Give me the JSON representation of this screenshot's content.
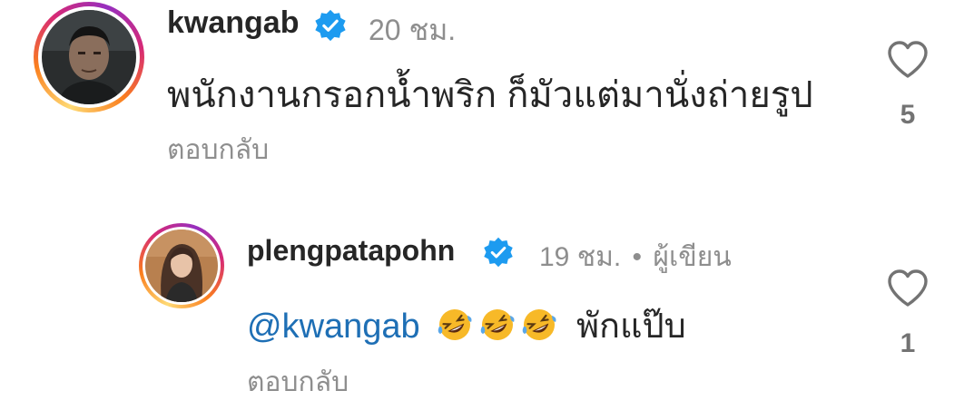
{
  "comments": [
    {
      "username": "kwangab",
      "time": "20 ชม.",
      "text": "พนักงานกรอกน้ำพริก ก็มัวแต่มานั่งถ่ายรูป",
      "reply_label": "ตอบกลับ",
      "likes": "5",
      "verified": true,
      "icons": [
        "avatar",
        "verified-badge-icon",
        "heart-outline-icon"
      ]
    }
  ],
  "replies": [
    {
      "username": "plengpatapohn",
      "time": "19 ชม.",
      "separator": "•",
      "author_badge": "ผู้เขียน",
      "mention": "@kwangab",
      "emoji": [
        "rolling-on-floor-laughing",
        "rolling-on-floor-laughing",
        "rolling-on-floor-laughing"
      ],
      "text": "พักแป๊บ",
      "reply_label": "ตอบกลับ",
      "likes": "1",
      "verified": true,
      "icons": [
        "avatar",
        "verified-badge-icon",
        "heart-outline-icon"
      ]
    }
  ],
  "colors": {
    "text": "#262626",
    "secondary": "#8e8e8e",
    "mention": "#1e6fb5",
    "verified": "#1d9bf0"
  }
}
